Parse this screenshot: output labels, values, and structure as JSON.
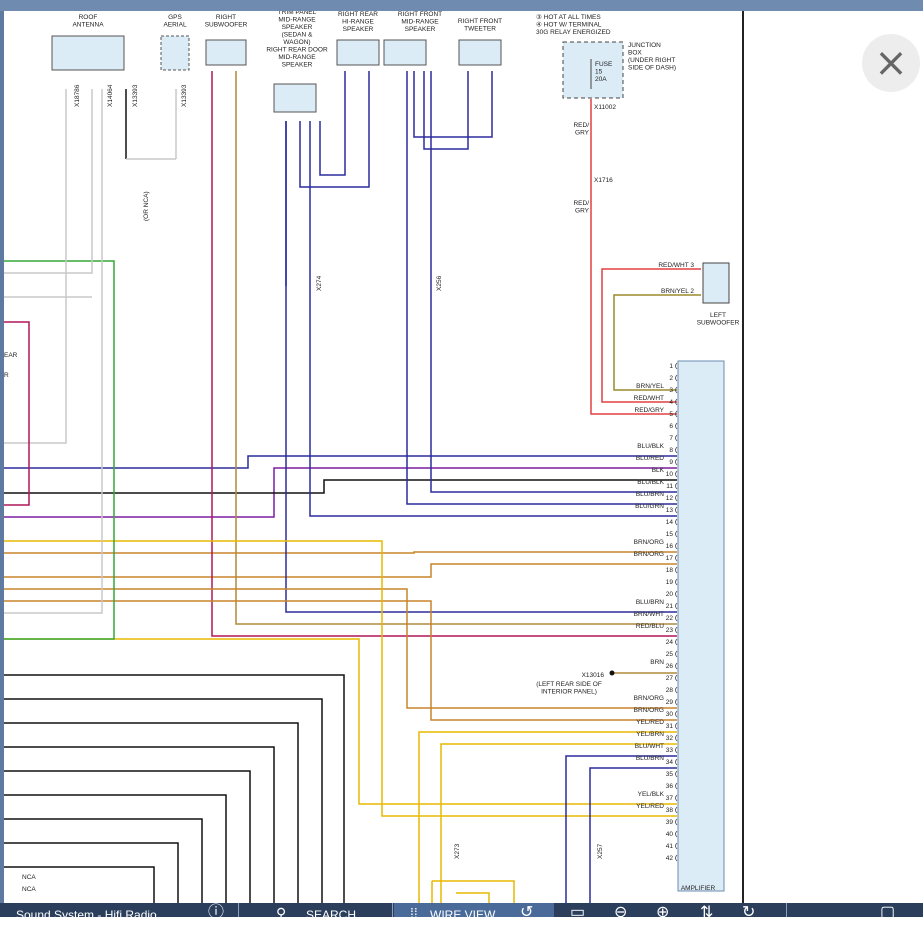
{
  "close_button": {
    "icon": "close-icon",
    "glyph": "×"
  },
  "toolbar": {
    "truncated_title": "Sound System - Hifi Radio",
    "search_label": "SEARCH",
    "wire_view_label": "WIRE VIEW",
    "icons": [
      "help-icon",
      "search-icon",
      "wire-view-icon",
      "history-icon",
      "print-icon",
      "zoom-out-icon",
      "zoom-in-icon",
      "settings-icon",
      "refresh-icon",
      "minimize-icon",
      "maximize-icon"
    ]
  },
  "diagram": {
    "components": {
      "roof_antenna": "ROOF\nANTENNA",
      "gps_aerial": "GPS\nAERIAL",
      "right_subwoofer": "RIGHT\nSUBWOOFER",
      "trim_panel": "TRIM PANEL\nMID-RANGE\nSPEAKER\n(SEDAN &\nWAGON)\nRIGHT REAR DOOR\nMID-RANGE\nSPEAKER",
      "right_rear_hi": "RIGHT REAR\nHI-RANGE\nSPEAKER",
      "right_front_mid": "RIGHT FRONT\nMID-RANGE\nSPEAKER",
      "right_front_tweeter": "RIGHT FRONT\nTWEETER",
      "junction_box": "JUNCTION\nBOX\n(UNDER RIGHT\nSIDE OF DASH)",
      "fuse": "FUSE\n15\n20A",
      "left_subwoofer": "LEFT\nSUBWOOFER",
      "amplifier": "AMPLIFIER"
    },
    "notes": [
      "③  HOT AT ALL TIMES",
      "④  HOT W/ TERMINAL",
      "30G RELAY ENERGIZED"
    ],
    "connectors": [
      "X18786",
      "X14064",
      "X13393",
      "X13393",
      "X11002",
      "X1716",
      "X274",
      "X256",
      "X273",
      "X257",
      "X13016"
    ],
    "ground_note": "(LEFT REAR SIDE OF\nINTERIOR PANEL)",
    "or_nca": "(OR NCA)",
    "left_partial": [
      "EAR",
      "R"
    ],
    "nca_labels": [
      "NCA",
      "NCA"
    ],
    "amp_pins": [
      {
        "n": 1,
        "label": ""
      },
      {
        "n": 2,
        "label": ""
      },
      {
        "n": 3,
        "label": "BRN/YEL"
      },
      {
        "n": 4,
        "label": "RED/WHT"
      },
      {
        "n": 5,
        "label": "RED/GRY"
      },
      {
        "n": 6,
        "label": ""
      },
      {
        "n": 7,
        "label": ""
      },
      {
        "n": 8,
        "label": "BLU/BLK"
      },
      {
        "n": 9,
        "label": "BLU/RED"
      },
      {
        "n": 10,
        "label": "BLK"
      },
      {
        "n": 11,
        "label": "BLU/BLK"
      },
      {
        "n": 12,
        "label": "BLU/BRN"
      },
      {
        "n": 13,
        "label": "BLU/GRN"
      },
      {
        "n": 14,
        "label": ""
      },
      {
        "n": 15,
        "label": ""
      },
      {
        "n": 16,
        "label": "BRN/ORG"
      },
      {
        "n": 17,
        "label": "BRN/ORG"
      },
      {
        "n": 18,
        "label": ""
      },
      {
        "n": 19,
        "label": ""
      },
      {
        "n": 20,
        "label": ""
      },
      {
        "n": 21,
        "label": "BLU/BRN"
      },
      {
        "n": 22,
        "label": "BRN/WHT"
      },
      {
        "n": 23,
        "label": "RED/BLU"
      },
      {
        "n": 24,
        "label": ""
      },
      {
        "n": 25,
        "label": ""
      },
      {
        "n": 26,
        "label": "BRN"
      },
      {
        "n": 27,
        "label": ""
      },
      {
        "n": 28,
        "label": ""
      },
      {
        "n": 29,
        "label": "BRN/ORG"
      },
      {
        "n": 30,
        "label": "BRN/ORG"
      },
      {
        "n": 31,
        "label": "YEL/RED"
      },
      {
        "n": 32,
        "label": "YEL/BRN"
      },
      {
        "n": 33,
        "label": "BLU/WHT"
      },
      {
        "n": 34,
        "label": "BLU/BRN"
      },
      {
        "n": 35,
        "label": ""
      },
      {
        "n": 36,
        "label": ""
      },
      {
        "n": 37,
        "label": "YEL/BLK"
      },
      {
        "n": 38,
        "label": "YEL/RED"
      },
      {
        "n": 39,
        "label": ""
      },
      {
        "n": 40,
        "label": ""
      },
      {
        "n": 41,
        "label": ""
      },
      {
        "n": 42,
        "label": ""
      }
    ],
    "wire_colors": {
      "green": "#36a836",
      "grey": "#c8c8c8",
      "crimson": "#b0175a",
      "purple": "#7a1fa0",
      "navy": "#2b2b9e",
      "black": "#111111",
      "orange": "#c8832a",
      "tan": "#b08a3c",
      "yellow": "#e8b800",
      "red": "#e04040",
      "olive": "#9c8a2a"
    }
  }
}
